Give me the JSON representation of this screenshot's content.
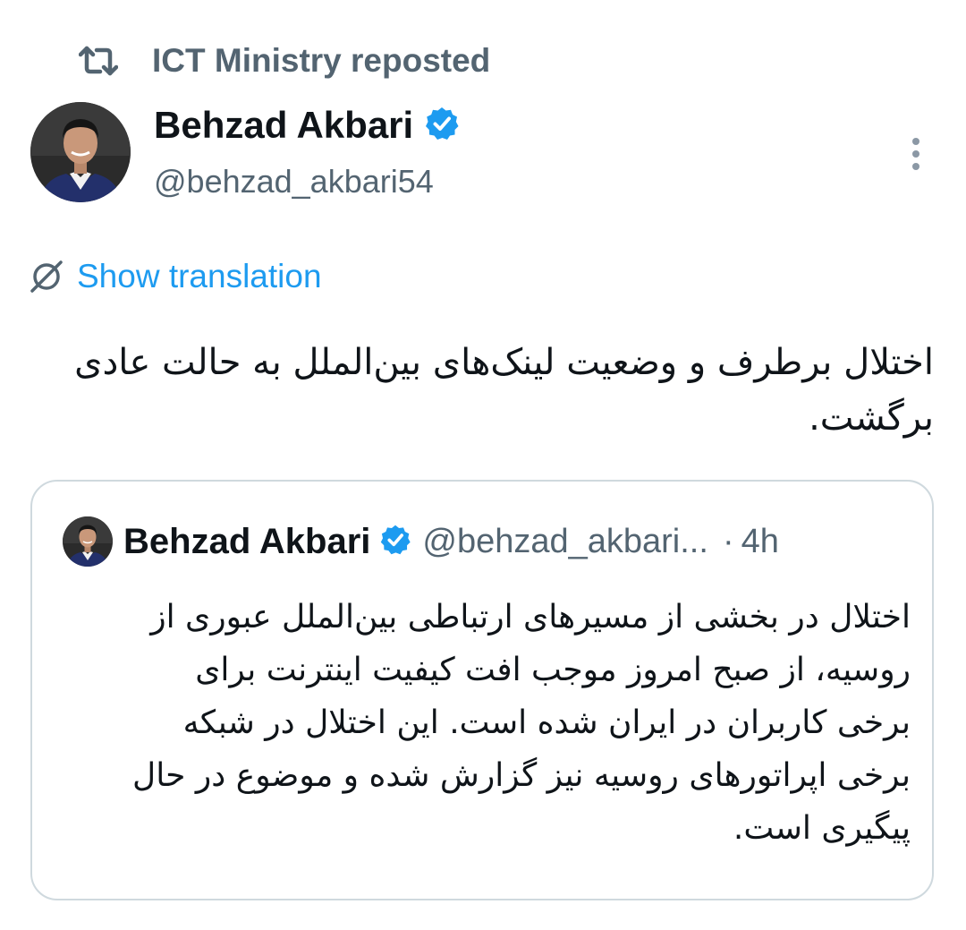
{
  "repost": {
    "icon": "repost-icon",
    "text": "ICT Ministry reposted"
  },
  "author": {
    "name": "Behzad Akbari",
    "handle": "@behzad_akbari54",
    "verified": true,
    "badge_color": "#1d9bf0"
  },
  "more_menu": {
    "icon": "more-vertical-icon"
  },
  "translation": {
    "icon": "globe-translate-icon",
    "label": "Show translation",
    "color": "#1d9bf0"
  },
  "tweet": {
    "text": "اختلال برطرف و وضعیت لینک‌های بین‌الملل به حالت عادی برگشت."
  },
  "quoted_tweet": {
    "name": "Behzad Akbari",
    "handle": "@behzad_akbari...",
    "separator": "·",
    "time": "4h",
    "text": "اختلال در بخشی از مسیرهای ارتباطی بین‌الملل عبوری از روسیه، از صبح امروز موجب افت کیفیت اینترنت برای برخی کاربران در ایران شده است. این اختلال در شبکه برخی اپراتورهای روسیه نیز گزارش شده و موضوع در حال پیگیری است."
  },
  "colors": {
    "text_primary": "#0f1419",
    "text_secondary": "#536471",
    "border": "#cfd9de",
    "accent": "#1d9bf0"
  }
}
